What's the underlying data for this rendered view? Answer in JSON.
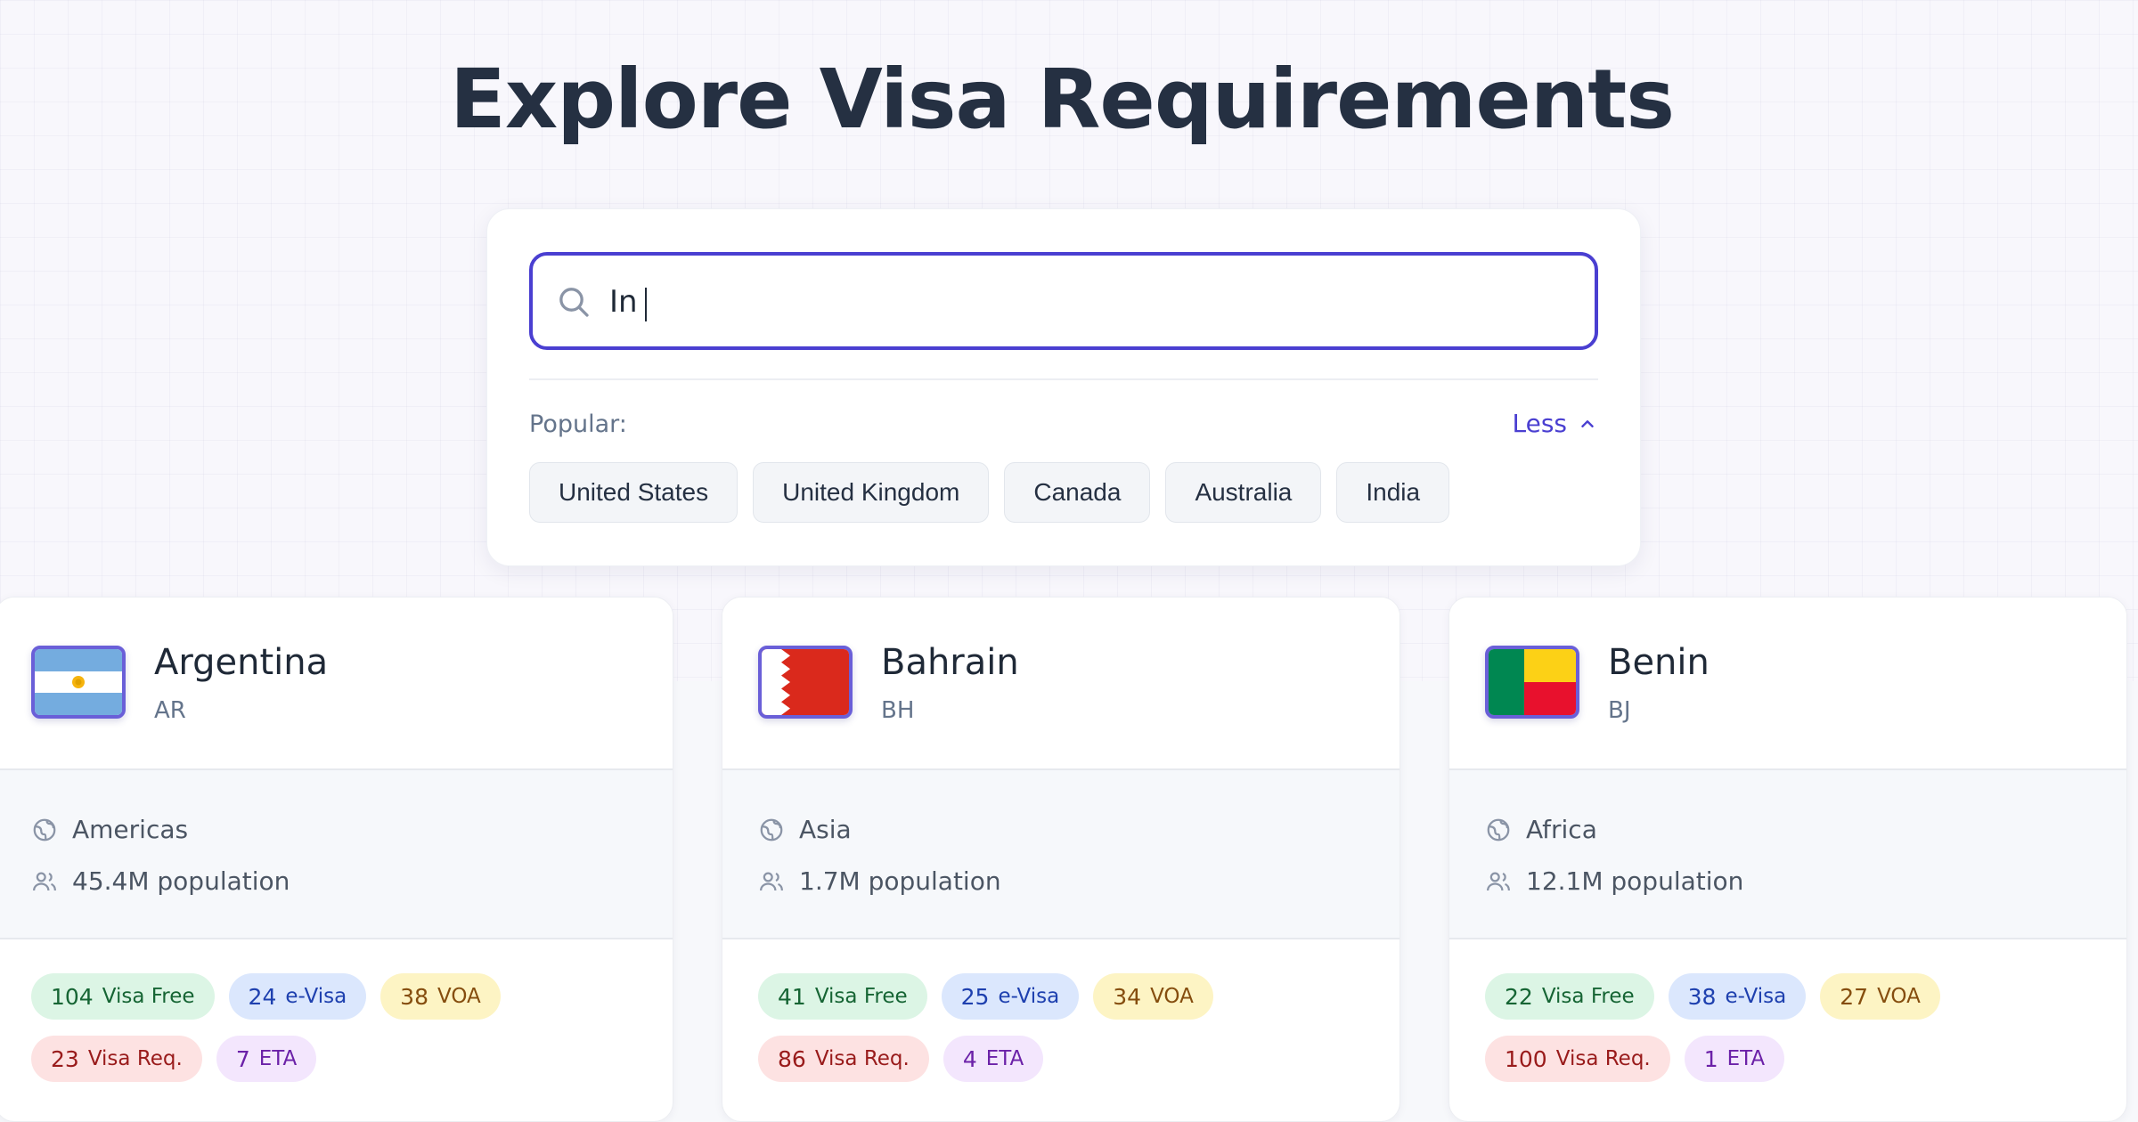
{
  "page": {
    "title": "Explore Visa Requirements"
  },
  "search": {
    "value": "In",
    "popular_label": "Popular:",
    "toggle_label": "Less"
  },
  "popular": [
    "United States",
    "United Kingdom",
    "Canada",
    "Australia",
    "India"
  ],
  "countries": [
    {
      "name": "Argentina",
      "code": "AR",
      "region": "Americas",
      "population": "45.4M population",
      "badges": {
        "visa_free": "104",
        "evisa": "24",
        "voa": "38",
        "visa_req": "23",
        "eta": "7"
      }
    },
    {
      "name": "Bahrain",
      "code": "BH",
      "region": "Asia",
      "population": "1.7M population",
      "badges": {
        "visa_free": "41",
        "evisa": "25",
        "voa": "34",
        "visa_req": "86",
        "eta": "4"
      }
    },
    {
      "name": "Benin",
      "code": "BJ",
      "region": "Africa",
      "population": "12.1M population",
      "badges": {
        "visa_free": "22",
        "evisa": "38",
        "voa": "27",
        "visa_req": "100",
        "eta": "1"
      }
    }
  ],
  "badge_labels": {
    "visa_free": "Visa Free",
    "evisa": "e-Visa",
    "voa": "VOA",
    "visa_req": "Visa Req.",
    "eta": "ETA"
  },
  "colors": {
    "accent": "#4a3fd1",
    "title": "#253042"
  }
}
